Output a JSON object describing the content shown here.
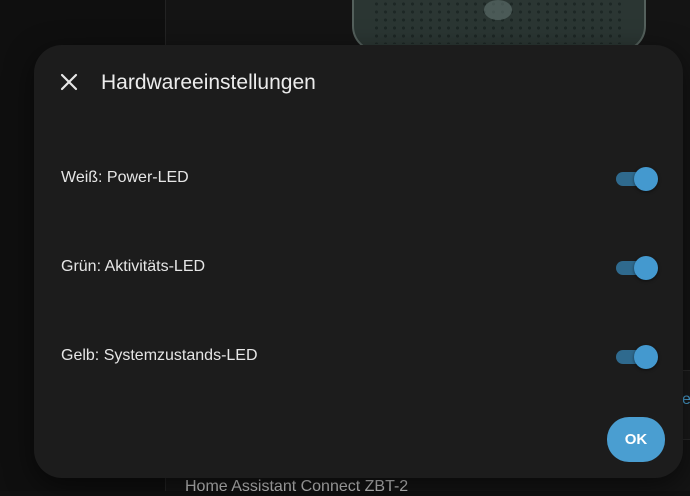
{
  "background": {
    "card_text": "Home Assistant Connect ZBT-2",
    "right_panel_char": "e"
  },
  "dialog": {
    "title": "Hardwareeinstellungen",
    "close_icon": "close-icon",
    "settings": [
      {
        "label": "Weiß: Power-LED",
        "enabled": true
      },
      {
        "label": "Grün: Aktivitäts-LED",
        "enabled": true
      },
      {
        "label": "Gelb: Systemzustands-LED",
        "enabled": true
      }
    ],
    "ok_label": "OK"
  },
  "colors": {
    "accent": "#4a9ed1",
    "switch_track": "#2f6a8e",
    "dialog_bg": "#1c1c1c",
    "page_bg": "#111111"
  }
}
